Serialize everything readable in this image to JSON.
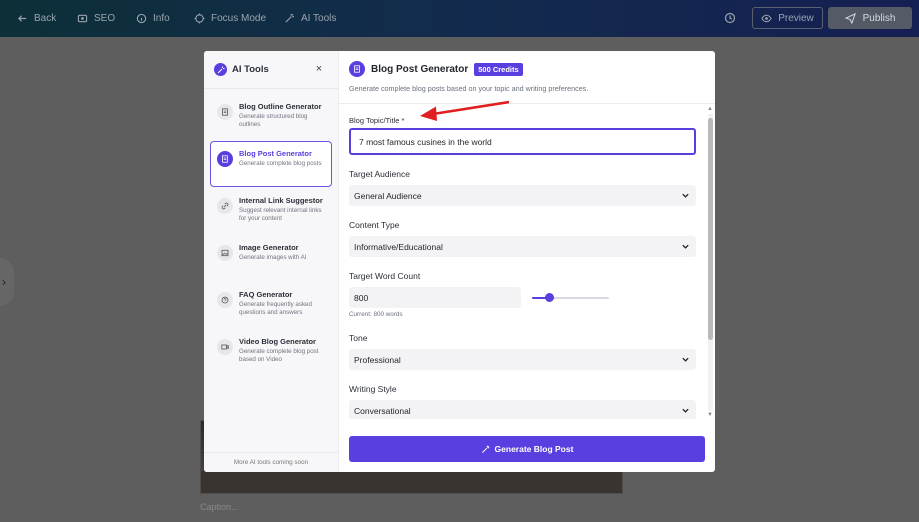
{
  "topbar": {
    "back": "Back",
    "seo": "SEO",
    "info": "Info",
    "focus_mode": "Focus Mode",
    "ai_tools": "AI Tools",
    "preview": "Preview",
    "publish": "Publish"
  },
  "background": {
    "caption_placeholder": "Caption..."
  },
  "sidebar": {
    "title": "AI Tools",
    "close_symbol": "×",
    "items": [
      {
        "name": "Blog Outline Generator",
        "desc": "Generate structured blog outlines",
        "icon": "document-icon",
        "active": false
      },
      {
        "name": "Blog Post Generator",
        "desc": "Generate complete blog posts",
        "icon": "document-icon",
        "active": true
      },
      {
        "name": "Internal Link Suggestor",
        "desc": "Suggest relevant internal links for your content",
        "icon": "link-icon",
        "active": false
      },
      {
        "name": "Image Generator",
        "desc": "Generate images with AI",
        "icon": "image-icon",
        "active": false
      },
      {
        "name": "FAQ Generator",
        "desc": "Generate frequently asked questions and answers",
        "icon": "question-icon",
        "active": false
      },
      {
        "name": "Video Blog Generator",
        "desc": "Generate complete blog post based on Video",
        "icon": "video-icon",
        "active": false
      }
    ],
    "footer": "More AI tools coming soon"
  },
  "main": {
    "title": "Blog Post Generator",
    "credits": "500 Credits",
    "subtitle": "Generate complete blog posts based on your topic and writing preferences.",
    "topic_label": "Blog Topic/Title *",
    "topic_value": "7 most famous cusines in the world",
    "audience_label": "Target Audience",
    "audience_value": "General Audience",
    "content_type_label": "Content Type",
    "content_type_value": "Informative/Educational",
    "word_count_label": "Target Word Count",
    "word_count_value": "800",
    "word_count_note": "Current: 800 words",
    "word_count_slider_fraction": 0.22,
    "tone_label": "Tone",
    "tone_value": "Professional",
    "style_label": "Writing Style",
    "style_value": "Conversational",
    "generate_button": "Generate Blog Post"
  },
  "colors": {
    "accent": "#5a3fe0",
    "annotation_arrow": "#e02020"
  }
}
